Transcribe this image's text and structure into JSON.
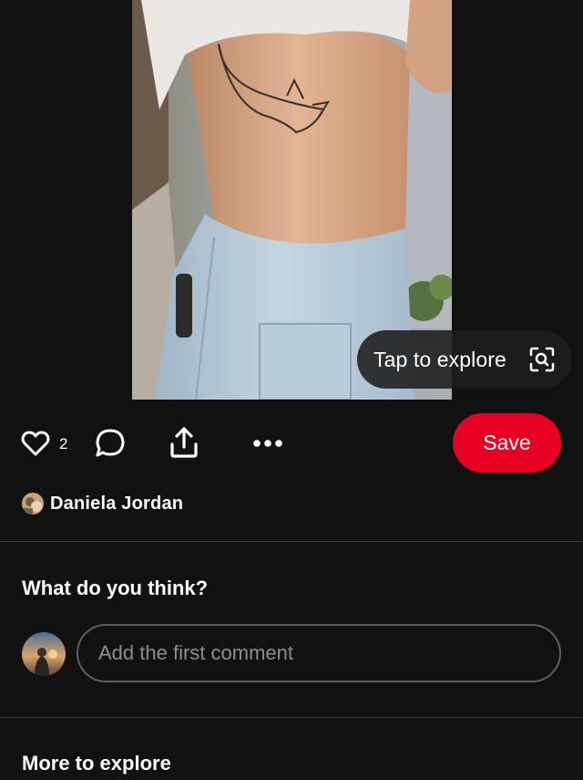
{
  "pin": {
    "image_icon": "photo-rib-tattoo-shark",
    "explore_label": "Tap to explore",
    "explore_icon": "visual-search-lens-icon"
  },
  "actions": {
    "like_icon": "heart-outline-icon",
    "like_count": "2",
    "comment_icon": "speech-bubble-icon",
    "share_icon": "share-upload-icon",
    "more_icon": "ellipsis-icon",
    "save_label": "Save",
    "save_color": "#e60023"
  },
  "creator": {
    "name": "Daniela Jordan"
  },
  "comments": {
    "heading": "What do you think?",
    "placeholder": "Add the first comment"
  },
  "more": {
    "heading": "More to explore"
  },
  "colors": {
    "background": "#111111",
    "divider": "#3a3a3a",
    "accent": "#e60023"
  }
}
